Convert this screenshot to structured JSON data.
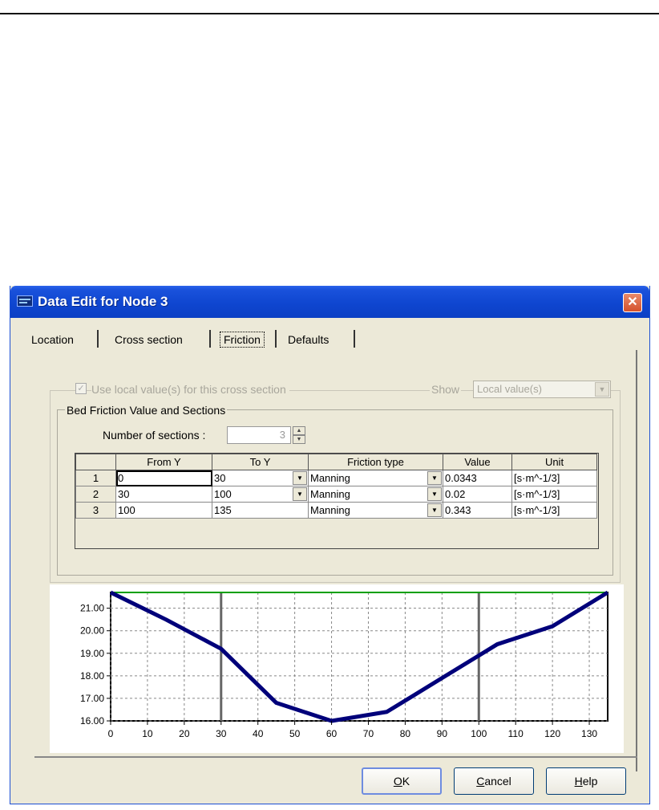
{
  "window": {
    "title": "Data Edit for Node 3",
    "close_glyph": "✕"
  },
  "tabs": [
    {
      "label": "Location"
    },
    {
      "label": "Cross section"
    },
    {
      "label": "Friction",
      "active": true
    },
    {
      "label": "Defaults"
    }
  ],
  "options": {
    "use_local_label": "Use local value(s) for this cross section",
    "use_local_checked": true,
    "show_label": "Show",
    "show_value": "Local value(s)"
  },
  "bed_friction": {
    "group_label": "Bed Friction Value and Sections",
    "num_sections_label": "Number of sections :",
    "num_sections_value": "3"
  },
  "table": {
    "columns": [
      "",
      "From Y",
      "To Y",
      "Friction type",
      "Value",
      "Unit"
    ],
    "rows": [
      {
        "n": "1",
        "from": "0",
        "to": "30",
        "type": "Manning",
        "value": "0.0343",
        "unit": "[s·m^-1/3]"
      },
      {
        "n": "2",
        "from": "30",
        "to": "100",
        "type": "Manning",
        "value": "0.02",
        "unit": "[s·m^-1/3]"
      },
      {
        "n": "3",
        "from": "100",
        "to": "135",
        "type": "Manning",
        "value": "0.343",
        "unit": "[s·m^-1/3]"
      }
    ]
  },
  "chart_data": {
    "type": "line",
    "x": [
      0,
      15,
      30,
      45,
      60,
      75,
      90,
      100,
      105,
      120,
      135
    ],
    "series": [
      {
        "values": [
          21.7,
          20.5,
          19.2,
          16.8,
          16.0,
          16.4,
          17.9,
          18.9,
          19.4,
          20.2,
          21.7
        ],
        "color": "#00007a"
      }
    ],
    "section_boundaries": [
      30,
      100
    ],
    "water_level": 21.7,
    "water_color": "#00a000",
    "xlim": [
      0,
      135
    ],
    "ylim": [
      16,
      21.7
    ],
    "xticks": [
      0,
      10,
      20,
      30,
      40,
      50,
      60,
      70,
      80,
      90,
      100,
      110,
      120,
      130
    ],
    "yticks": [
      16.0,
      17.0,
      18.0,
      19.0,
      20.0,
      21.0
    ],
    "ytick_labels": [
      "16.00",
      "17.00",
      "18.00",
      "19.00",
      "20.00",
      "21.00"
    ],
    "grid": true,
    "title": "",
    "xlabel": "",
    "ylabel": ""
  },
  "buttons": {
    "ok": {
      "accel": "O",
      "rest": "K"
    },
    "cancel": {
      "accel": "C",
      "rest": "ancel"
    },
    "help": {
      "accel": "H",
      "rest": "elp"
    }
  }
}
